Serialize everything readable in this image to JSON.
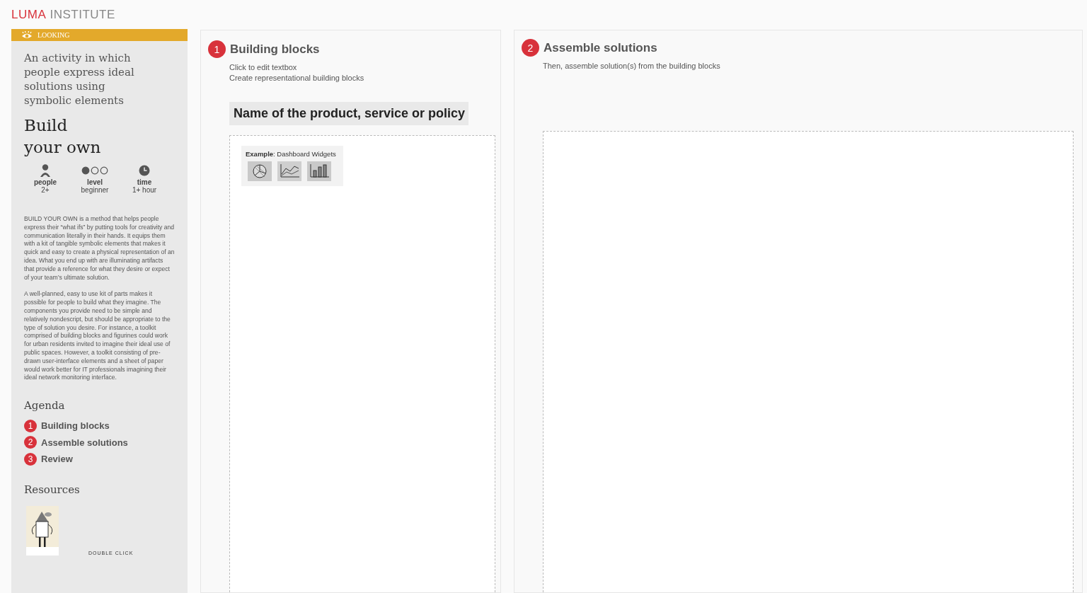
{
  "logo": {
    "accent": "LUMA",
    "rest": "INSTITUTE"
  },
  "sidebar": {
    "category": "LOOKING",
    "summary": "An activity in which people express ideal solutions using symbolic elements",
    "title_lines": [
      "Build",
      "your own"
    ],
    "stats": [
      {
        "kind": "people",
        "label": "people",
        "value": "2+"
      },
      {
        "kind": "level",
        "label": "level",
        "value": "beginner",
        "level": 0.33
      },
      {
        "kind": "time",
        "label": "time",
        "value": "1+ hour"
      }
    ],
    "paragraphs": [
      "BUILD YOUR OWN is a method that helps people express their “what ifs” by putting tools for creativity and communication literally in their hands. It equips them with a kit of tangible symbolic elements that makes it quick and easy to create a physical representation of an idea. What you end up with are illuminating artifacts that provide a reference for what they desire or expect of your team’s ultimate solution.",
      "A well-planned, easy to use kit of parts makes it possible for people to build what they imagine. The components you provide need to be simple and relatively nondescript, but should be appropriate to the type of solution you desire. For instance, a toolkit comprised of building blocks and figurines could work for urban residents invited to imagine their ideal use of public spaces. However, a toolkit consisting of pre-drawn user-interface elements and a sheet of paper would work better for IT professionals imagining their ideal network monitoring interface."
    ],
    "agenda_heading": "Agenda",
    "agenda": [
      {
        "number": "1",
        "label": "Building blocks"
      },
      {
        "number": "2",
        "label": "Assemble solutions"
      },
      {
        "number": "3",
        "label": "Review"
      }
    ],
    "resources_heading": "Resources",
    "resource_hint": "DOUBLE CLICK"
  },
  "panels": [
    {
      "number": "1",
      "title": "Building blocks",
      "notes": [
        "Click to edit textbox",
        "Create representational building blocks"
      ],
      "name_box": "Name of the product, service or policy",
      "example": {
        "label": "Example",
        "text": ": Dashboard Widgets",
        "sketches": [
          {
            "kind": "pie"
          },
          {
            "kind": "line"
          },
          {
            "kind": "bar"
          }
        ]
      }
    },
    {
      "number": "2",
      "title": "Assemble solutions",
      "notes": [
        "Then, assemble solution(s) from the building blocks"
      ]
    }
  ]
}
